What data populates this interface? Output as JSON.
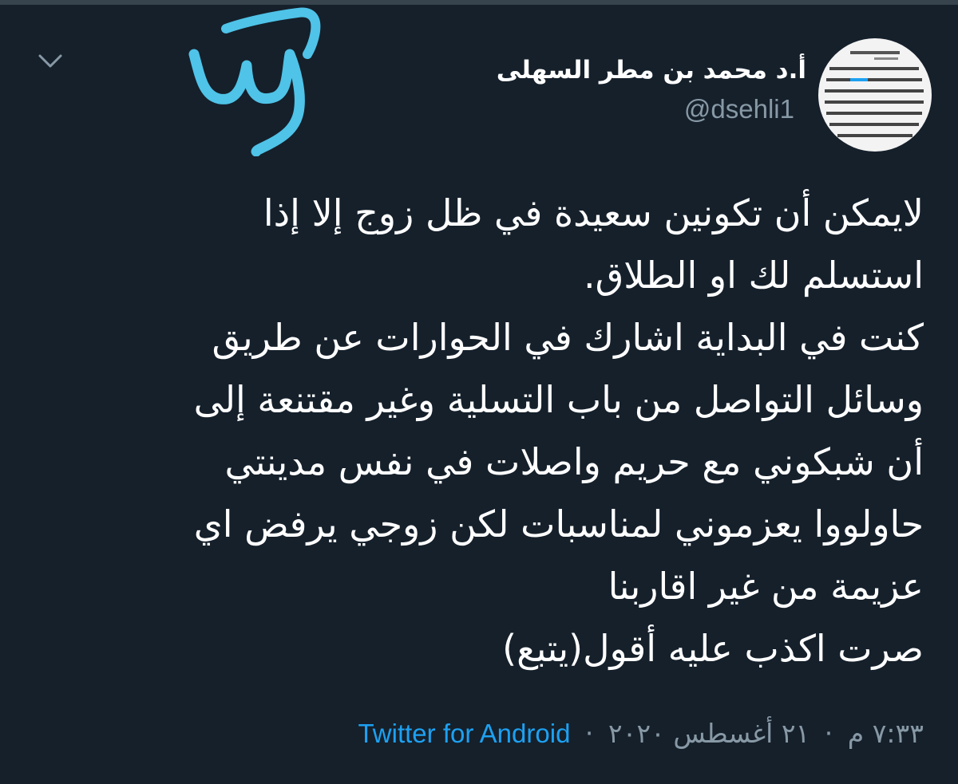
{
  "tweet": {
    "display_name": "أ.د محمد بن مطر السهلى",
    "handle": "@dsehli1",
    "body_lines": [
      "لايمكن أن تكونين سعيدة في ظل زوج إلا إذا",
      "استسلم لك او الطلاق.",
      "كنت في البداية اشارك في الحوارات عن طريق",
      "وسائل التواصل من باب التسلية وغير مقتنعة إلى",
      "أن شبكوني مع حريم واصلات في نفس مدينتي",
      "حاولووا يعزموني لمناسبات لكن زوجي يرفض اي",
      "عزيمة من غير اقاربنا",
      "صرت اكذب عليه أقول(يتبع)"
    ],
    "time": "٧:٣٣ م",
    "date": "٢١ أغسطس ٢٠٢٠",
    "separator": "·",
    "source": "Twitter for Android"
  },
  "icons": {
    "menu": "chevron-down-icon",
    "avatar": "profile-avatar"
  },
  "colors": {
    "background": "#15202b",
    "text": "#ffffff",
    "muted": "#8899a6",
    "link": "#1da1f2",
    "annotation": "#4fc3e8"
  }
}
